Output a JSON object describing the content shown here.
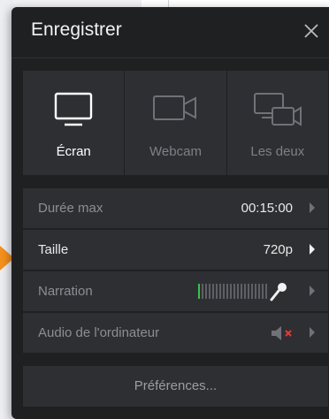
{
  "dialog": {
    "title": "Enregistrer",
    "close_icon": "close-icon"
  },
  "modes": [
    {
      "label": "Écran",
      "icon": "monitor-icon",
      "active": true
    },
    {
      "label": "Webcam",
      "icon": "webcam-icon",
      "active": false
    },
    {
      "label": "Les deux",
      "icon": "screen-and-webcam-icon",
      "active": false
    }
  ],
  "settings": {
    "max_duration": {
      "label": "Durée max",
      "value": "00:15:00"
    },
    "size": {
      "label": "Taille",
      "value": "720p"
    },
    "narration": {
      "label": "Narration",
      "icon": "microphone-icon",
      "level": 0.1
    },
    "computer_audio": {
      "label": "Audio de l'ordinateur",
      "icon": "speaker-muted-icon"
    }
  },
  "preferences_label": "Préférences...",
  "colors": {
    "panel": "#1f2022",
    "row": "#2e2f32",
    "meter_active": "#3ec04a",
    "muted_x": "#e03a3a",
    "pointer_arrow": "#f4901e"
  }
}
